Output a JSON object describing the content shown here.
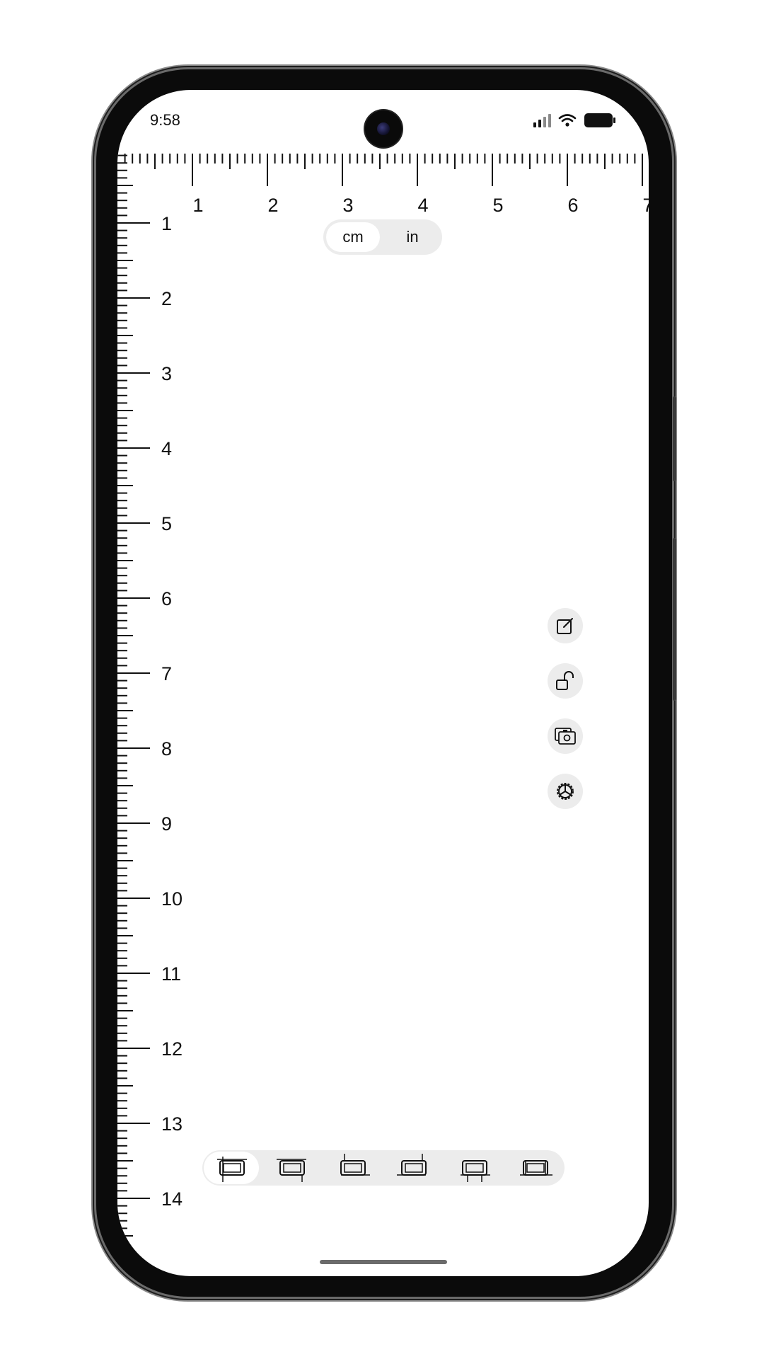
{
  "status_bar": {
    "time": "9:58"
  },
  "ruler": {
    "top_labels": [
      "1",
      "2",
      "3",
      "4",
      "5",
      "6",
      "7"
    ],
    "left_labels": [
      "1",
      "2",
      "3",
      "4",
      "5",
      "6",
      "7",
      "8",
      "9",
      "10",
      "11",
      "12",
      "13",
      "14"
    ]
  },
  "unit_toggle": {
    "options": [
      "cm",
      "in"
    ],
    "selected": "cm"
  },
  "side_tools": [
    {
      "icon": "edit-icon"
    },
    {
      "icon": "unlock-icon"
    },
    {
      "icon": "camera-icon"
    },
    {
      "icon": "settings-icon"
    }
  ],
  "measure_modes": {
    "selected_index": 0,
    "items": [
      "mode-1",
      "mode-2",
      "mode-3",
      "mode-4",
      "mode-5",
      "mode-6"
    ]
  },
  "colors": {
    "ink": "#111111",
    "pill_bg": "#ececec",
    "bezel": "#0b0b0b"
  }
}
